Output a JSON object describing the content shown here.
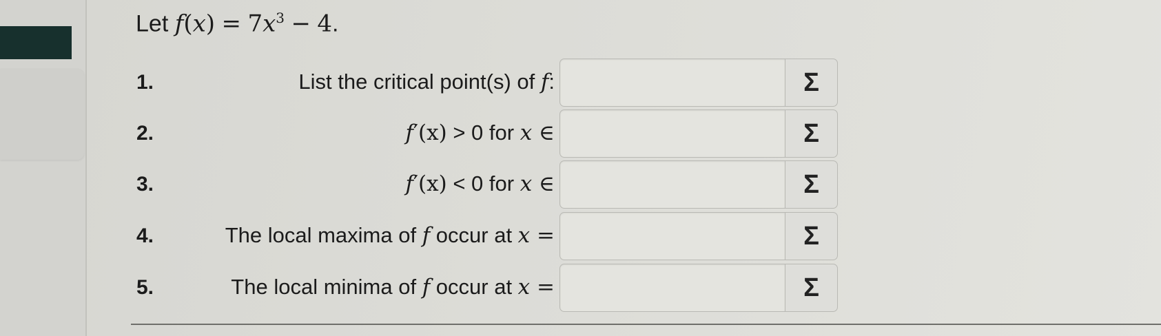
{
  "problem": {
    "let_word": "Let",
    "f": "f",
    "open_paren": "(",
    "x": "x",
    "close_paren": ")",
    "equals": "=",
    "coef": "7",
    "exp": "3",
    "minus": "−",
    "const": "4",
    "period": "."
  },
  "questions": [
    {
      "num": "1.",
      "pre": "List the critical point(s) of ",
      "sym": "f",
      "post": ":"
    },
    {
      "num": "2.",
      "sym": "f",
      "prime": "′",
      "arg": "(x)",
      "op": " > 0 for ",
      "var": "x",
      "elem": " ∈"
    },
    {
      "num": "3.",
      "sym": "f",
      "prime": "′",
      "arg": "(x)",
      "op": " < 0 for ",
      "var": "x",
      "elem": " ∈"
    },
    {
      "num": "4.",
      "pre": "The local maxima of ",
      "sym": "f",
      "mid": " occur at ",
      "var": "x",
      "post": " ="
    },
    {
      "num": "5.",
      "pre": "The local minima of ",
      "sym": "f",
      "mid": " occur at ",
      "var": "x",
      "post": " ="
    }
  ],
  "answers": [
    "",
    "",
    "",
    "",
    ""
  ],
  "sigma_label": "Σ",
  "colors": {
    "sidebar_tab": "#17302d",
    "background": "#dcdcd7",
    "box_border": "#b9b9b4"
  }
}
